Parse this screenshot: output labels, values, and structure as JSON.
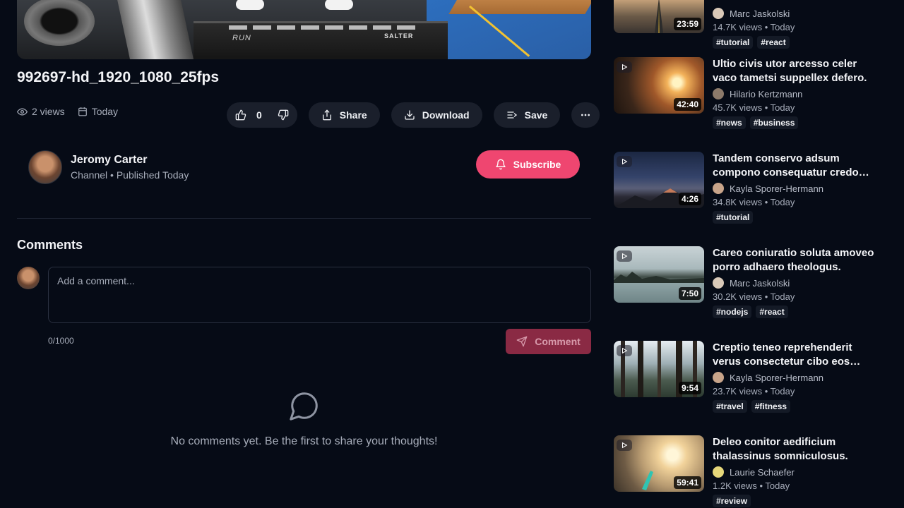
{
  "player": {
    "run_label": "RUN",
    "brand_label": "SALTER"
  },
  "video": {
    "title": "992697-hd_1920_1080_25fps",
    "views": "2 views",
    "date": "Today",
    "likes": "0",
    "share_label": "Share",
    "download_label": "Download",
    "save_label": "Save"
  },
  "channel": {
    "name": "Jeromy Carter",
    "subtitle": "Channel • Published Today",
    "subscribe_label": "Subscribe"
  },
  "comments": {
    "title": "Comments",
    "placeholder": "Add a comment...",
    "char_count": "0/1000",
    "submit_label": "Comment",
    "empty_text": "No comments yet. Be the first to share your thoughts!"
  },
  "recommendations": [
    {
      "title": "",
      "author": "Marc Jaskolski",
      "stats": "14.7K views • Today",
      "duration": "23:59",
      "tags": [
        "#tutorial",
        "#react"
      ]
    },
    {
      "title": "Ultio civis utor arcesso celer vaco tametsi suppellex defero.",
      "author": "Hilario Kertzmann",
      "stats": "45.7K views • Today",
      "duration": "42:40",
      "tags": [
        "#news",
        "#business"
      ]
    },
    {
      "title": "Tandem conservo adsum compono consequatur credo…",
      "author": "Kayla Sporer-Hermann",
      "stats": "34.8K views • Today",
      "duration": "4:26",
      "tags": [
        "#tutorial"
      ]
    },
    {
      "title": "Careo coniuratio soluta amoveo porro adhaero theologus.",
      "author": "Marc Jaskolski",
      "stats": "30.2K views • Today",
      "duration": "7:50",
      "tags": [
        "#nodejs",
        "#react"
      ]
    },
    {
      "title": "Creptio teneo reprehenderit verus consectetur cibo eos…",
      "author": "Kayla Sporer-Hermann",
      "stats": "23.7K views • Today",
      "duration": "9:54",
      "tags": [
        "#travel",
        "#fitness"
      ]
    },
    {
      "title": "Deleo conitor aedificium thalassinus somniculosus.",
      "author": "Laurie Schaefer",
      "stats": "1.2K views • Today",
      "duration": "59:41",
      "tags": [
        "#review"
      ]
    }
  ]
}
